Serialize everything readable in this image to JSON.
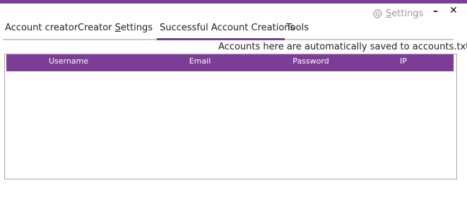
{
  "header": {
    "settings_label": "Settings",
    "settings_icon": "gear-icon",
    "minimize_glyph": "–",
    "close_glyph": "✕"
  },
  "tabs": [
    {
      "label": "Account creator"
    },
    {
      "label_prefix": "Creator ",
      "label_accel": "S",
      "label_suffix": "ettings"
    },
    {
      "label": "Successful Account Creations",
      "active": true
    },
    {
      "label": "Tools"
    }
  ],
  "notice": "Accounts here are automatically saved to accounts.txt",
  "table": {
    "columns": [
      "Username",
      "Email",
      "Password",
      "IP"
    ],
    "rows": []
  },
  "colors": {
    "accent": "#7b3d96",
    "tab_rule": "#c9c9c9",
    "settings_text": "#9a9a9a"
  }
}
